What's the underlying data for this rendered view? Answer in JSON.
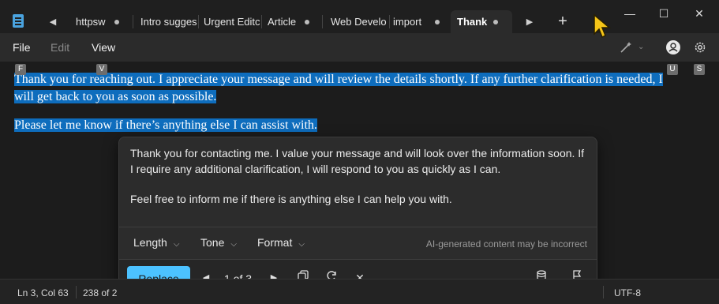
{
  "tabs": [
    {
      "label": "httpsw"
    },
    {
      "label": "Intro sugges"
    },
    {
      "label": "Urgent Editc"
    },
    {
      "label": "Article"
    },
    {
      "label": "Web Develo"
    },
    {
      "label": "import"
    },
    {
      "label": "Thank"
    }
  ],
  "window_controls": {
    "minimize": "—",
    "maximize": "☐",
    "close": "✕"
  },
  "new_tab": "+",
  "menu": {
    "file": "File",
    "edit": "Edit",
    "view": "View"
  },
  "key_tips": {
    "file": "F",
    "view": "V",
    "account": "U",
    "settings": "S"
  },
  "document": {
    "line1": "Thank you for reaching out. I appreciate your message and will review the details shortly. If any further clarification is needed, I",
    "line2": "will get back to you as soon as possible.",
    "line3": "Please let me know if there’s anything else I can assist with."
  },
  "rewrite_panel": {
    "paragraph1": "Thank you for contacting me. I value your message and will look over the information soon. If I require any additional clarification, I will respond to you as quickly as I can.",
    "paragraph2": "Feel free to inform me if there is anything else I can help you with.",
    "options": {
      "length": "Length",
      "tone": "Tone",
      "format": "Format"
    },
    "disclaimer": "AI-generated content may be incorrect",
    "replace": "Replace",
    "pager": "1 of 3"
  },
  "status": {
    "position": "Ln 3, Col 63",
    "chars": "238 of 2",
    "encoding": "UTF-8"
  },
  "colors": {
    "accent": "#4cc2ff",
    "selection": "#0e6dbd",
    "cursor": "#f5c518"
  }
}
